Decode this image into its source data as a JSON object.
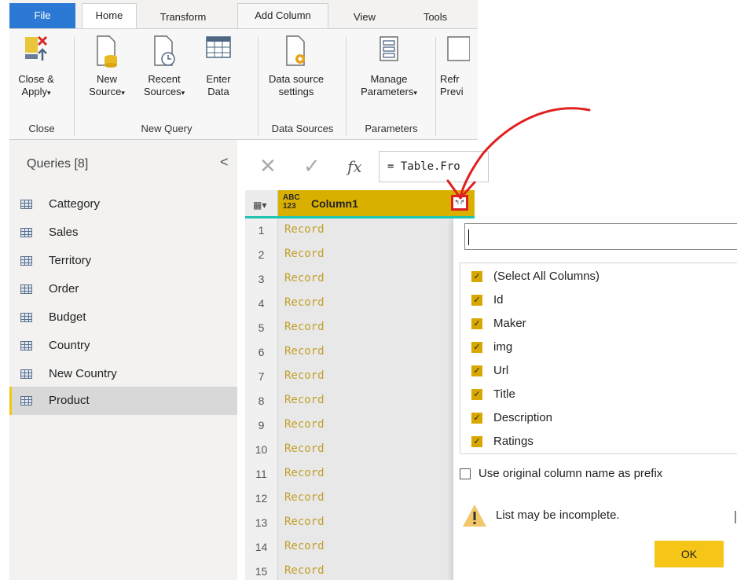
{
  "ribbon": {
    "tabs": [
      {
        "label": "File"
      },
      {
        "label": "Home"
      },
      {
        "label": "Transform"
      },
      {
        "label": "Add Column"
      },
      {
        "label": "View"
      },
      {
        "label": "Tools"
      }
    ],
    "buttons": {
      "close_apply": "Close &\nApply",
      "new_source": "New\nSource",
      "recent_sources": "Recent\nSources",
      "enter_data": "Enter\nData",
      "data_source_settings": "Data source\nsettings",
      "manage_parameters": "Manage\nParameters",
      "refresh_preview": "Refr\nPrevi"
    },
    "caret": "▾",
    "groups": {
      "close": "Close",
      "new_query": "New Query",
      "data_sources": "Data Sources",
      "parameters": "Parameters"
    }
  },
  "queries": {
    "title": "Queries [8]",
    "collapse": "<",
    "items": [
      {
        "label": "Cattegory"
      },
      {
        "label": "Sales"
      },
      {
        "label": "Territory"
      },
      {
        "label": "Order"
      },
      {
        "label": "Budget"
      },
      {
        "label": "Country"
      },
      {
        "label": "New Country"
      },
      {
        "label": "Product"
      }
    ],
    "selected": "Product"
  },
  "formula": {
    "cancel": "✕",
    "commit": "✓",
    "fx": "fx",
    "expression": "= Table.Fro"
  },
  "grid": {
    "column_type_top": "ABC",
    "column_type_bottom": "123",
    "column_name": "Column1",
    "expand_glyph": "↰↱",
    "rows": [
      {
        "n": "1",
        "v": "Record"
      },
      {
        "n": "2",
        "v": "Record"
      },
      {
        "n": "3",
        "v": "Record"
      },
      {
        "n": "4",
        "v": "Record"
      },
      {
        "n": "5",
        "v": "Record"
      },
      {
        "n": "6",
        "v": "Record"
      },
      {
        "n": "7",
        "v": "Record"
      },
      {
        "n": "8",
        "v": "Record"
      },
      {
        "n": "9",
        "v": "Record"
      },
      {
        "n": "10",
        "v": "Record"
      },
      {
        "n": "11",
        "v": "Record"
      },
      {
        "n": "12",
        "v": "Record"
      },
      {
        "n": "13",
        "v": "Record"
      },
      {
        "n": "14",
        "v": "Record"
      },
      {
        "n": "15",
        "v": "Record"
      }
    ]
  },
  "expand_panel": {
    "search_value": "",
    "columns": [
      {
        "label": "(Select All Columns)",
        "checked": true
      },
      {
        "label": "Id",
        "checked": true
      },
      {
        "label": "Maker",
        "checked": true
      },
      {
        "label": "img",
        "checked": true
      },
      {
        "label": "Url",
        "checked": true
      },
      {
        "label": "Title",
        "checked": true
      },
      {
        "label": "Description",
        "checked": true
      },
      {
        "label": "Ratings",
        "checked": true
      }
    ],
    "check_glyph": "✓",
    "prefix_label": "Use original column name as prefix",
    "prefix_checked": false,
    "warning": "List may be incomplete.",
    "ok_label": "OK"
  },
  "colors": {
    "accent_yellow": "#f5c518",
    "file_tab_blue": "#2b79d4",
    "annotation_red": "#e02020",
    "record_text": "#c2a02a"
  }
}
